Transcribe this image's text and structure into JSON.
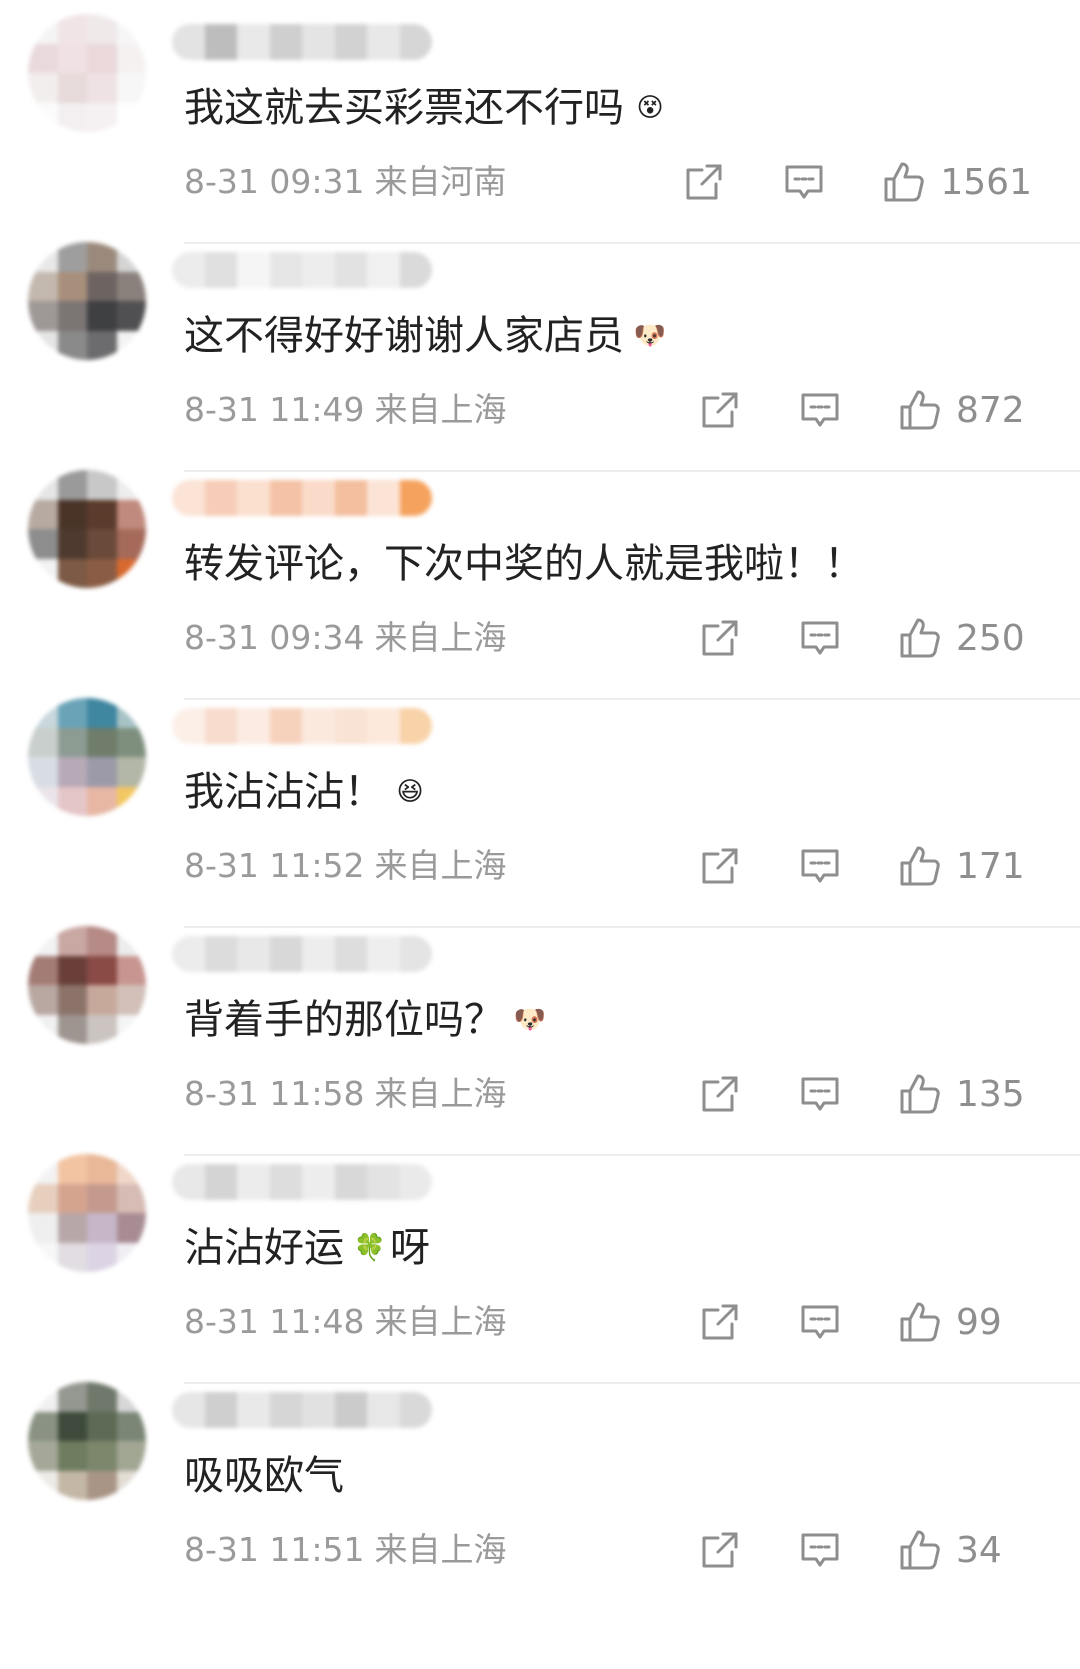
{
  "comments": [
    {
      "text": "我这就去买彩票还不行吗",
      "emoji": "glasses-face-emoji",
      "emoji_glyph": "😵",
      "date": "8-31 09:31",
      "location": "来自河南",
      "likes": "1561",
      "avatar_colors": [
        "#f4f4f4",
        "#f1e4e6",
        "#efe9ea",
        "#f6f6f6",
        "#ead9dc",
        "#f0e1e4",
        "#ead8da",
        "#f5f1f1",
        "#f3eeee",
        "#e7dada",
        "#eee2e4",
        "#f7f7f7",
        "#fbfbfb",
        "#f3eff0",
        "#f5f0f1",
        "#ffffff"
      ],
      "username_colors": [
        "#e3e3e3",
        "#bdbdbd",
        "#e9e9e9",
        "#cfcfcf",
        "#e4e4e4",
        "#d2d2d2",
        "#e8e8e8",
        "#d6d6d6"
      ]
    },
    {
      "text": "这不得好好谢谢人家店员",
      "emoji": "doge-emoji",
      "emoji_glyph": "🐶",
      "date": "8-31 11:49",
      "location": "来自上海",
      "likes": "872",
      "avatar_colors": [
        "#e8e8e8",
        "#9e9e9e",
        "#9b8a7c",
        "#d4d4d4",
        "#c3b8ae",
        "#a88f7b",
        "#6d6462",
        "#8a817c",
        "#9e9896",
        "#7b7574",
        "#3f4042",
        "#505052",
        "#e5e5e5",
        "#8a8a8a",
        "#6c6c6e",
        "#f3f3f3"
      ],
      "username_colors": [
        "#ececec",
        "#e0e0e0",
        "#f5f5f5",
        "#e6e6e6",
        "#ededed",
        "#e2e2e2",
        "#f0f0f0",
        "#dadada"
      ]
    },
    {
      "text": "转发评论，下次中奖的人就是我啦！！",
      "emoji": "",
      "emoji_glyph": "",
      "date": "8-31 09:34",
      "location": "来自上海",
      "likes": "250",
      "avatar_colors": [
        "#e6e6e6",
        "#9a9a9a",
        "#c8c8c8",
        "#ededed",
        "#b7aaa1",
        "#4a3428",
        "#5b3b2c",
        "#c18a7e",
        "#8d8d8d",
        "#4e3a2e",
        "#6a4a3a",
        "#a56a5a",
        "#f2f2f2",
        "#7c5a45",
        "#8a5c45",
        "#d8692e"
      ],
      "username_colors": [
        "#fbe3d6",
        "#f6cdb8",
        "#fbe0d0",
        "#f4c2a6",
        "#fadbc9",
        "#f3bf9e",
        "#fbe4d6",
        "#f5a25e"
      ]
    },
    {
      "text": "我沾沾沾！",
      "emoji": "excited-face-emoji",
      "emoji_glyph": "😆",
      "date": "8-31 11:52",
      "location": "来自上海",
      "likes": "171",
      "avatar_colors": [
        "#c7d7dc",
        "#6aa3b8",
        "#3f86a0",
        "#a7c3c6",
        "#c9cfcc",
        "#8c9c93",
        "#6f7d6a",
        "#7e8f7e",
        "#d8dde4",
        "#b8a9b7",
        "#9c9aa9",
        "#b3b7a7",
        "#eae4ea",
        "#e5c6c8",
        "#e7b7a4",
        "#f3c761"
      ],
      "username_colors": [
        "#fcefe8",
        "#f8dccd",
        "#fcebe2",
        "#f6d2bd",
        "#fbe9de",
        "#f9e3d4",
        "#fde9dc",
        "#f8d2a8"
      ]
    },
    {
      "text": "背着手的那位吗？",
      "emoji": "doge-emoji",
      "emoji_glyph": "🐶",
      "date": "8-31 11:58",
      "location": "来自上海",
      "likes": "135",
      "avatar_colors": [
        "#f2f2f2",
        "#c9a7a3",
        "#b68a86",
        "#ececec",
        "#a47c76",
        "#6a3f3a",
        "#8a4a46",
        "#c89590",
        "#b9a7a2",
        "#8c7369",
        "#c7a99c",
        "#d2c0b9",
        "#f0f0f0",
        "#9e9590",
        "#cbc4c0",
        "#f5f5f5"
      ],
      "username_colors": [
        "#ececec",
        "#dcdcdc",
        "#e8e8e8",
        "#d8d8d8",
        "#ededed",
        "#dddddd",
        "#eeeeee",
        "#e4e4e4"
      ]
    },
    {
      "text": "沾沾好运",
      "text_after": "呀",
      "emoji": "four-leaf-clover-emoji",
      "emoji_glyph": "🍀",
      "date": "8-31 11:48",
      "location": "来自上海",
      "likes": "99",
      "avatar_colors": [
        "#f3f3f3",
        "#f2c4a2",
        "#e9b899",
        "#f0d7c8",
        "#e7cfbe",
        "#d5a48f",
        "#c49a8e",
        "#d7bcb5",
        "#efefef",
        "#b8a7a8",
        "#c6b6c8",
        "#a88c94",
        "#f7f7f7",
        "#e1dde2",
        "#dcd4e4",
        "#f1eef3"
      ],
      "username_colors": [
        "#e8e8e8",
        "#d4d4d4",
        "#ececec",
        "#dddddd",
        "#ededed",
        "#d8d8d8",
        "#e3e3e3",
        "#eaeaea"
      ]
    },
    {
      "text": "吸吸欧气",
      "emoji": "",
      "emoji_glyph": "",
      "date": "8-31 11:51",
      "location": "来自上海",
      "likes": "34",
      "avatar_colors": [
        "#f0f0f0",
        "#949890",
        "#6f786a",
        "#d7d7d7",
        "#8a9283",
        "#3e4a3c",
        "#5d6a55",
        "#7b8677",
        "#a5a898",
        "#6e7c5f",
        "#7c876c",
        "#a2a793",
        "#ecebe6",
        "#c4b7a6",
        "#a99586",
        "#e2ddd5"
      ],
      "username_colors": [
        "#e6e6e6",
        "#cfcfcf",
        "#e9e9e9",
        "#d6d6d6",
        "#e1e1e1",
        "#cbcbcb",
        "#e7e7e7",
        "#d9d9d9"
      ]
    }
  ],
  "colors": {
    "meta": "#9a9a9a",
    "text": "#222222",
    "icon": "#8e8e8e",
    "divider": "#ececec"
  },
  "icons": {
    "share": "share-icon",
    "reply": "comment-icon",
    "like": "thumbs-up-icon"
  }
}
